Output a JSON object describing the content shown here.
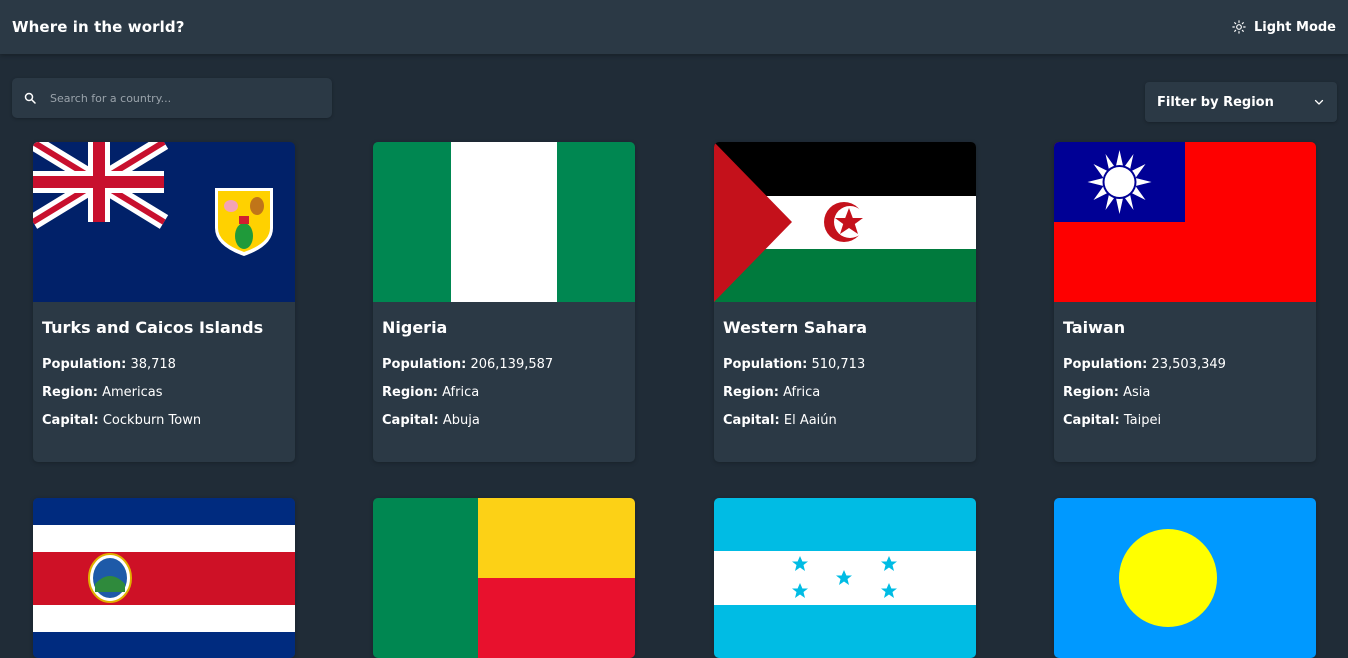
{
  "header": {
    "title": "Where in the world?",
    "theme_toggle_label": "Light Mode"
  },
  "search": {
    "placeholder": "Search for a country..."
  },
  "filter": {
    "label": "Filter by Region"
  },
  "labels": {
    "population": "Population:",
    "region": "Region:",
    "capital": "Capital:"
  },
  "countries": [
    {
      "name": "Turks and Caicos Islands",
      "population": "38,718",
      "region": "Americas",
      "capital": "Cockburn Town"
    },
    {
      "name": "Nigeria",
      "population": "206,139,587",
      "region": "Africa",
      "capital": "Abuja"
    },
    {
      "name": "Western Sahara",
      "population": "510,713",
      "region": "Africa",
      "capital": "El Aaiún"
    },
    {
      "name": "Taiwan",
      "population": "23,503,349",
      "region": "Asia",
      "capital": "Taipei"
    }
  ],
  "more_flags": [
    "costa-rica-flag",
    "benin-flag",
    "honduras-flag",
    "palau-flag"
  ],
  "colors": {
    "background": "#202c37",
    "element": "#2b3945",
    "text": "#ffffff"
  }
}
